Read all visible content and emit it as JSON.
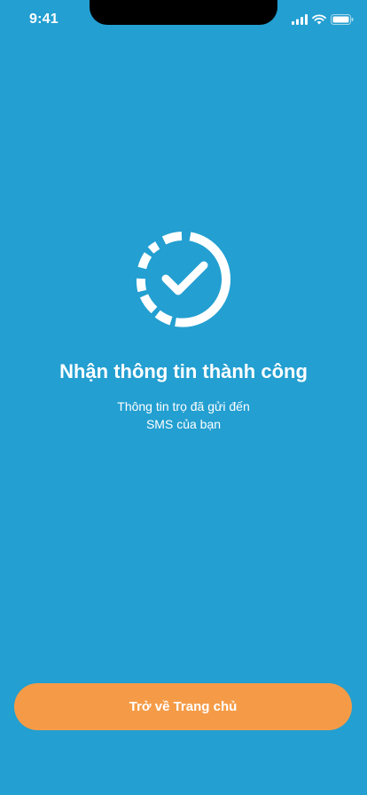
{
  "status_bar": {
    "time": "9:41",
    "icons": [
      "signal-icon",
      "wifi-icon",
      "battery-icon"
    ]
  },
  "main": {
    "icon": "check-circle-icon",
    "title": "Nhận thông tin thành công",
    "subtitle_line1": "Thông tin trọ đã gửi đến",
    "subtitle_line2": "SMS của bạn"
  },
  "footer": {
    "home_button_label": "Trở về Trang chủ"
  },
  "colors": {
    "background": "#239fd1",
    "button": "#f59b47",
    "text": "#ffffff"
  }
}
